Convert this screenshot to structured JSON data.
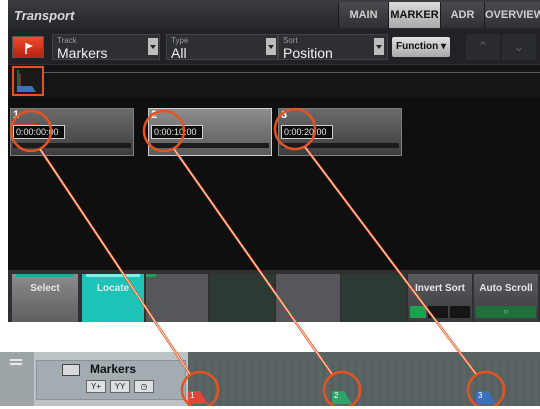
{
  "app": {
    "title": "Transport"
  },
  "tabs": [
    {
      "label": "MAIN",
      "active": false
    },
    {
      "label": "MARKER",
      "active": true
    },
    {
      "label": "ADR",
      "active": false
    },
    {
      "label": "OVERVIEW",
      "active": false
    }
  ],
  "fields": {
    "track": {
      "label": "Track",
      "value": "Markers"
    },
    "type": {
      "label": "Type",
      "value": "All"
    },
    "sort": {
      "label": "Sort",
      "value": "Position"
    }
  },
  "buttons": {
    "function": "Function ▾"
  },
  "markers": [
    {
      "number": "1",
      "time": "0:00:00:00"
    },
    {
      "number": "2",
      "time": "0:00:10:00"
    },
    {
      "number": "3",
      "time": "0:00:20:00"
    }
  ],
  "bottom_buttons": [
    {
      "label": "Select",
      "accent": "#1fa7a0"
    },
    {
      "label": "Locate",
      "accent": "#1ec3b8"
    },
    {
      "label": "",
      "accent": "#1fa050"
    },
    {
      "label": "",
      "accent": ""
    },
    {
      "label": "",
      "accent": ""
    },
    {
      "label": "",
      "accent": ""
    },
    {
      "label": "Invert Sort",
      "accent": "#1fa050"
    },
    {
      "label": "Auto Scroll",
      "accent": "#1fa050"
    }
  ],
  "track_strip": {
    "name": "Markers",
    "markers": [
      {
        "number": "1",
        "color": "#e0453a"
      },
      {
        "number": "2",
        "color": "#2fa46a"
      },
      {
        "number": "3",
        "color": "#3d6fbf"
      }
    ]
  },
  "colors": {
    "callout": "#e5541f",
    "teal": "#1ec3b8",
    "green": "#1fa050"
  }
}
